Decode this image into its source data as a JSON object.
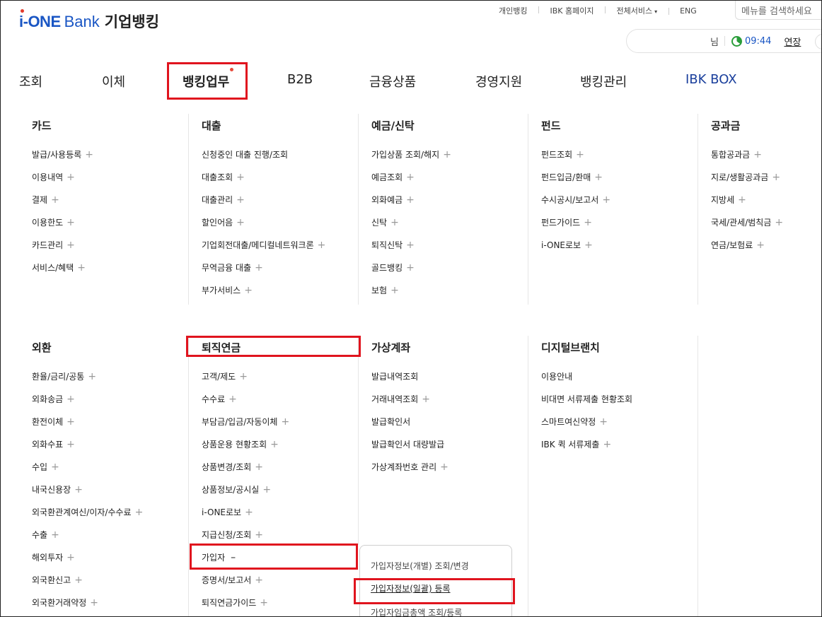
{
  "logo": {
    "brand": "i-ONE",
    "bank": "Bank",
    "ko": "기업뱅킹"
  },
  "topnav": {
    "items": [
      "개인뱅킹",
      "IBK 홈페이지",
      "전체서비스",
      "ENG"
    ],
    "caret": "▾"
  },
  "search": {
    "placeholder": "메뉴를 검색하세요"
  },
  "session": {
    "name_suffix": "님",
    "time": "09:44",
    "extend": "연장"
  },
  "gnb": {
    "tabs": [
      "조회",
      "이체",
      "뱅킹업무",
      "B2B",
      "금융상품",
      "경영지원",
      "뱅킹관리",
      "IBK BOX"
    ],
    "active": "뱅킹업무"
  },
  "menu": {
    "card": {
      "title": "카드",
      "items": [
        "발급/사용등록",
        "이용내역",
        "결제",
        "이용한도",
        "카드관리",
        "서비스/혜택"
      ]
    },
    "loan": {
      "title": "대출",
      "items": [
        "신청중인 대출 진행/조회",
        "대출조회",
        "대출관리",
        "할인어음",
        "기업회전대출/메디컬네트워크론",
        "무역금융 대출",
        "부가서비스"
      ]
    },
    "deposit": {
      "title": "예금/신탁",
      "items": [
        "가입상품 조회/해지",
        "예금조회",
        "외화예금",
        "신탁",
        "퇴직신탁",
        "골드뱅킹",
        "보험"
      ]
    },
    "fund": {
      "title": "펀드",
      "items": [
        "펀드조회",
        "펀드입금/환매",
        "수시공시/보고서",
        "펀드가이드",
        "i-ONE로보"
      ]
    },
    "public": {
      "title": "공과금",
      "items": [
        "통합공과금",
        "지로/생활공과금",
        "지방세",
        "국세/관세/범칙금",
        "연금/보험료"
      ]
    },
    "fx": {
      "title": "외환",
      "items": [
        "환율/금리/공통",
        "외화송금",
        "환전이체",
        "외화수표",
        "수입",
        "내국신용장",
        "외국환관계여신/이자/수수료",
        "수출",
        "해외투자",
        "외국환신고",
        "외국환거래약정"
      ]
    },
    "pension": {
      "title": "퇴직연금",
      "items": [
        "고객/제도",
        "수수료",
        "부담금/입금/자동이체",
        "상품운용 현황조회",
        "상품변경/조회",
        "상품정보/공시실",
        "i-ONE로보",
        "지급신청/조회",
        "가입자",
        "증명서/보고서",
        "퇴직연금가이드"
      ]
    },
    "virtual": {
      "title": "가상계좌",
      "items": [
        "발급내역조회",
        "거래내역조회",
        "발급확인서",
        "발급확인서 대량발급",
        "가상계좌번호 관리"
      ]
    },
    "digital": {
      "title": "디지털브랜치",
      "items": [
        "이용안내",
        "비대면 서류제출 현황조회",
        "스마트여신약정",
        "IBK 퀵 서류제출"
      ]
    }
  },
  "submenu": {
    "items": [
      "가입자정보(개별) 조회/변경",
      "가입자정보(일괄) 등록",
      "가입자임금총액 조회/등록"
    ]
  }
}
